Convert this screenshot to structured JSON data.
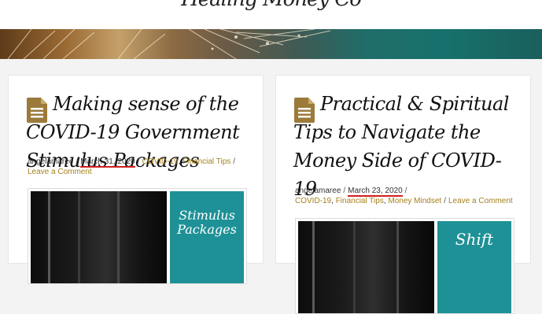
{
  "site": {
    "title": "Healing Money Co"
  },
  "colors": {
    "accent": "#a5801c",
    "teal": "#1e9197",
    "underline": "#d21f1f"
  },
  "posts": [
    {
      "title": "Making sense of the COVID-19 Government Stimulus Packages",
      "author": "angelamaree",
      "date": "March 31, 2020",
      "categories": [
        "COVID-19",
        "Financial Tips"
      ],
      "comment_link": "Leave a Comment",
      "thumbnail_text": "Stimulus Packages",
      "icon": "document-icon"
    },
    {
      "title": "Practical & Spiritual Tips to Navigate the Money Side of COVID-19",
      "author": "angelamaree",
      "date": "March 23, 2020",
      "categories": [
        "COVID-19",
        "Financial Tips",
        "Money Mindset"
      ],
      "comment_link": "Leave a Comment",
      "thumbnail_text": "Shift",
      "icon": "document-icon"
    }
  ]
}
